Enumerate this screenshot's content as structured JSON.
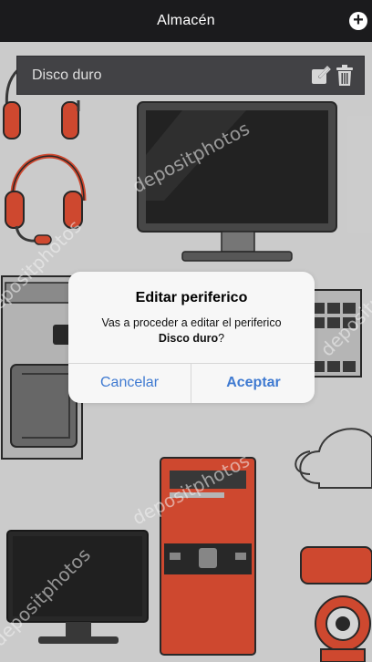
{
  "header": {
    "title": "Almacén",
    "add_icon": "plus-circle-icon"
  },
  "list": {
    "items": [
      {
        "label": "Disco duro",
        "edit_icon": "edit-icon",
        "delete_icon": "trash-icon"
      }
    ]
  },
  "dialog": {
    "title": "Editar periferico",
    "message_prefix": "Vas a proceder a editar el periferico",
    "item_name": "Disco duro",
    "message_suffix": "?",
    "cancel_label": "Cancelar",
    "accept_label": "Aceptar"
  },
  "background": {
    "watermark_text": "depositphotos"
  },
  "colors": {
    "topbar": "#1b1b1d",
    "accent": "#3f7ad1",
    "device_red": "#d6452a"
  }
}
